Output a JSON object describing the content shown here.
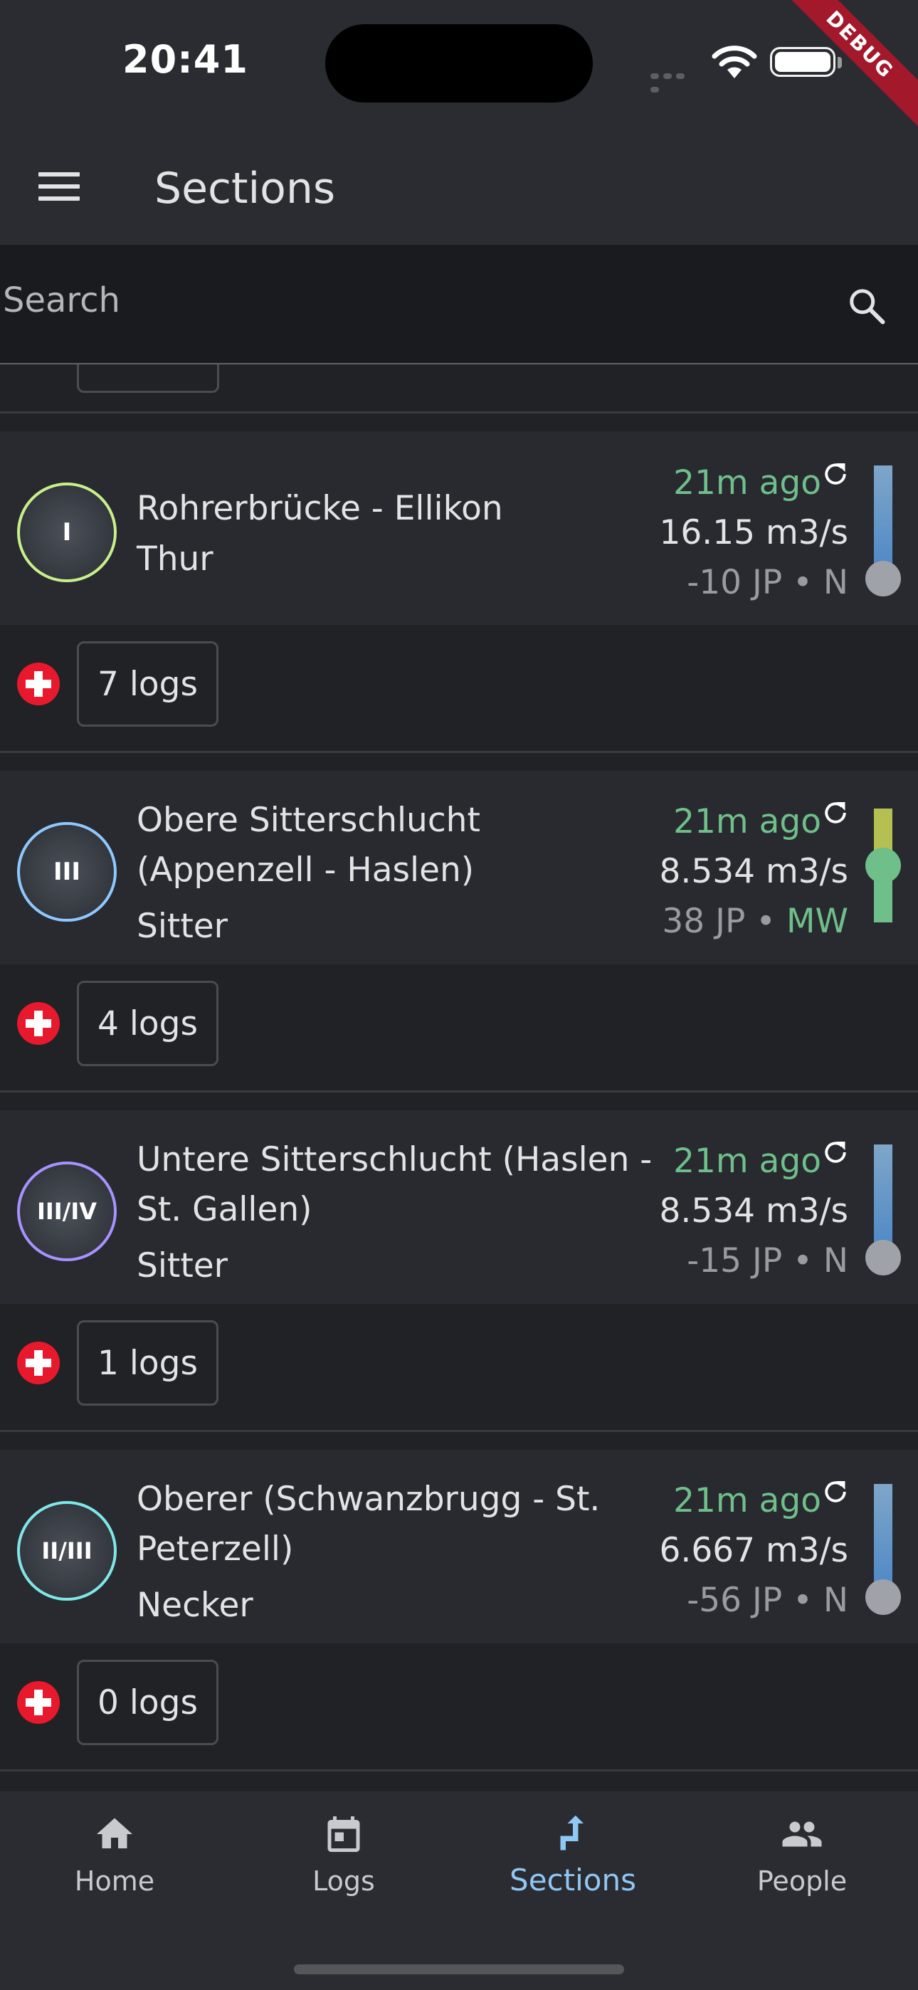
{
  "status_bar": {
    "time": "20:41",
    "debug_label": "DEBUG"
  },
  "app_bar": {
    "title": "Sections",
    "menu_icon": "menu-icon"
  },
  "search": {
    "placeholder": "Search",
    "icon": "search-icon"
  },
  "colors": {
    "accent": "#8fc7f5",
    "fresh": "#6fbf8a",
    "swiss_red": "#e8192c"
  },
  "sections": [
    {
      "grade": "I",
      "name_lines": [
        "Rohrerbrücke - Ellikon"
      ],
      "river": "Thur",
      "updated": "21m ago",
      "flow": "16.15 m3/s",
      "jp": "-10 JP",
      "level": "N",
      "logs": "7 logs",
      "badge_color": "#c8f08a"
    },
    {
      "grade": "III",
      "name_lines": [
        "Obere Sitterschlucht",
        "(Appenzell - Haslen)"
      ],
      "river": "Sitter",
      "updated": "21m ago",
      "flow": "8.534 m3/s",
      "jp": "38 JP",
      "level": "MW",
      "logs": "4 logs",
      "badge_color": "#8ec8ff"
    },
    {
      "grade": "III/IV",
      "name_lines": [
        "Untere Sitterschlucht (Haslen -",
        "St. Gallen)"
      ],
      "river": "Sitter",
      "updated": "21m ago",
      "flow": "8.534 m3/s",
      "jp": "-15 JP",
      "level": "N",
      "logs": "1 logs",
      "badge_color": "#a792ff"
    },
    {
      "grade": "II/III",
      "name_lines": [
        "Oberer (Schwanzbrugg - St.",
        "Peterzell)"
      ],
      "river": "Necker",
      "updated": "21m ago",
      "flow": "6.667 m3/s",
      "jp": "-56 JP",
      "level": "N",
      "logs": "0 logs",
      "badge_color": "#7fe7e8"
    }
  ],
  "bottom_nav": [
    {
      "label": "Home",
      "icon": "home-icon"
    },
    {
      "label": "Logs",
      "icon": "calendar-icon"
    },
    {
      "label": "Sections",
      "icon": "route-icon",
      "active": true
    },
    {
      "label": "People",
      "icon": "people-icon"
    }
  ]
}
